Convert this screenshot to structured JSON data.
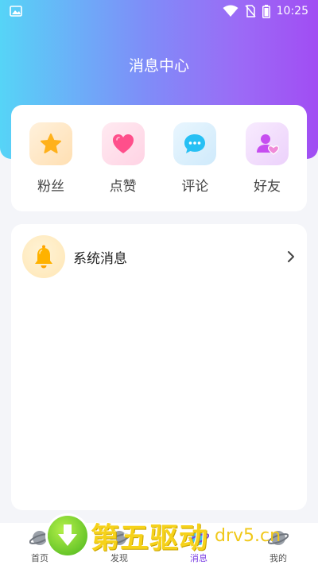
{
  "status_bar": {
    "time": "10:25",
    "icons": [
      "image-icon",
      "wifi-icon",
      "no-sim-icon",
      "battery-icon"
    ]
  },
  "header": {
    "title": "消息中心"
  },
  "categories": [
    {
      "label": "粉丝",
      "icon": "star-icon",
      "bg": "#ffe9c9",
      "color": "#ffb11b"
    },
    {
      "label": "点赞",
      "icon": "heart-icon",
      "bg": "#ffe0ec",
      "color": "#ff4f8b"
    },
    {
      "label": "评论",
      "icon": "comment-icon",
      "bg": "#dff2fd",
      "color": "#27c0f4"
    },
    {
      "label": "好友",
      "icon": "friend-icon",
      "bg": "#f4e1fd",
      "color": "#c64df0"
    }
  ],
  "messages": [
    {
      "title": "系统消息",
      "icon": "bell-icon"
    }
  ],
  "tabbar": {
    "tabs": [
      {
        "label": "首页",
        "icon": "planet-icon",
        "active": false
      },
      {
        "label": "发现",
        "icon": "planet-icon",
        "active": false
      },
      {
        "label": "消息",
        "icon": "planet-icon",
        "active": true
      },
      {
        "label": "我的",
        "icon": "planet-icon",
        "active": false
      }
    ]
  },
  "watermark": {
    "text_cn": "第五驱动",
    "text_en": "drv5.cn"
  },
  "colors": {
    "gradient_start": "#56d4f7",
    "gradient_end": "#a14df3",
    "active_tab": "#7b3fe4"
  }
}
